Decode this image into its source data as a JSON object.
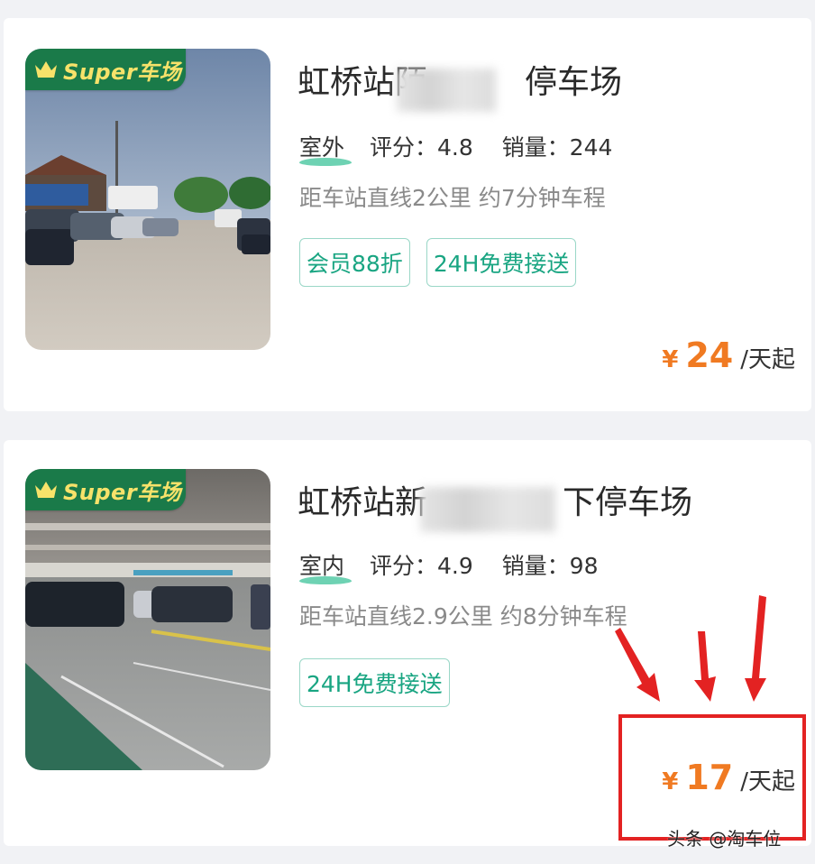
{
  "badge_text": "Super车场",
  "colors": {
    "badge_bg": "#1a7a49",
    "badge_text": "#f7e26a",
    "tag_green": "#19a582",
    "price_orange": "#f07a22",
    "highlight_red": "#e32222"
  },
  "listings": [
    {
      "title_start": "虹桥站陌",
      "title_end": "停车场",
      "type": "室外",
      "rating_label": "评分：",
      "rating": "4.8",
      "sales_label": "销量：",
      "sales": "244",
      "distance": "距车站直线2公里 约7分钟车程",
      "tags": [
        "会员88折",
        "24H免费接送"
      ],
      "currency": "¥",
      "price": "24",
      "price_unit": "/天起"
    },
    {
      "title_start": "虹桥站新",
      "title_end": "下停车场",
      "type": "室内",
      "rating_label": "评分：",
      "rating": "4.9",
      "sales_label": "销量：",
      "sales": "98",
      "distance": "距车站直线2.9公里 约8分钟车程",
      "tags": [
        "24H免费接送"
      ],
      "currency": "¥",
      "price": "17",
      "price_unit": "/天起"
    }
  ],
  "watermark": "头条 @淘车位"
}
